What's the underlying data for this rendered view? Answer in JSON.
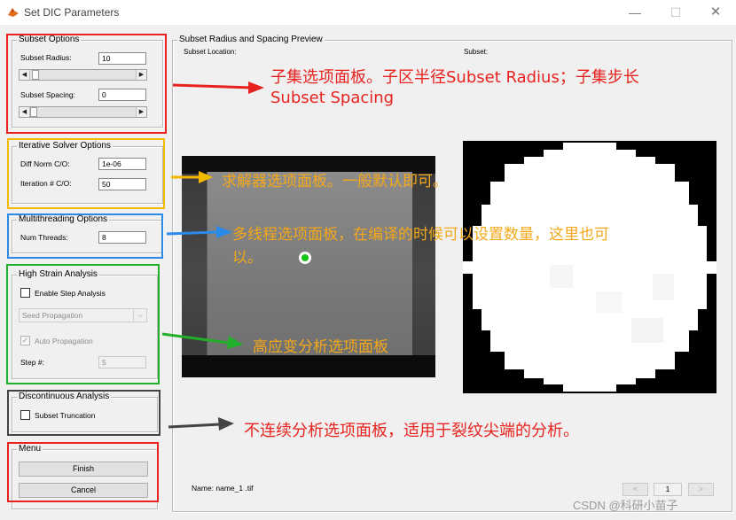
{
  "window": {
    "title": "Set DIC Parameters",
    "minimize": "—",
    "maximize": "☐",
    "close": "✕"
  },
  "subset_options": {
    "title": "Subset Options",
    "radius_label": "Subset Radius:",
    "radius_value": "10",
    "spacing_label": "Subset Spacing:",
    "spacing_value": "0"
  },
  "solver_options": {
    "title": "Iterative Solver Options",
    "diffnorm_label": "Diff Norm C/O:",
    "diffnorm_value": "1e-06",
    "iter_label": "Iteration # C/O:",
    "iter_value": "50"
  },
  "multithreading": {
    "title": "Multithreading Options",
    "threads_label": "Num Threads:",
    "threads_value": "8"
  },
  "high_strain": {
    "title": "High Strain Analysis",
    "enable_label": "Enable Step Analysis",
    "seed_propagation": "Seed Propagation",
    "auto_label": "Auto Propagation",
    "step_label": "Step #:",
    "step_value": "5"
  },
  "discontinuous": {
    "title": "Discontinuous Analysis",
    "truncation_label": "Subset Truncation"
  },
  "menu": {
    "title": "Menu",
    "finish": "Finish",
    "cancel": "Cancel"
  },
  "preview": {
    "title": "Subset Radius and Spacing Preview",
    "location_label": "Subset Location:",
    "subset_label": "Subset:",
    "name_label": "Name: name_1 .tif",
    "page_value": "1",
    "prev": "<",
    "next": ">"
  },
  "annotations": {
    "subset_line1": "子集选项面板。子区半径Subset Radius；子集步长",
    "subset_line2": "Subset Spacing",
    "solver": "求解器选项面板。一般默认即可。",
    "multithread_line1": "多线程选项面板，在编译的时候可以设置数量，这里也可",
    "multithread_line2": "以。",
    "high_strain": "高应变分析选项面板",
    "discontinuous": "不连续分析选项面板，适用于裂纹尖端的分析。"
  },
  "watermark": "CSDN @科研小苗子",
  "colors": {
    "annotation_red": "#e8231f",
    "annotation_orange": "#f4a81a",
    "highlight_yellow": "#f5b800",
    "highlight_blue": "#2b8ae8",
    "highlight_green": "#22b02a",
    "highlight_gray": "#444444",
    "marker_green": "#15c415"
  }
}
